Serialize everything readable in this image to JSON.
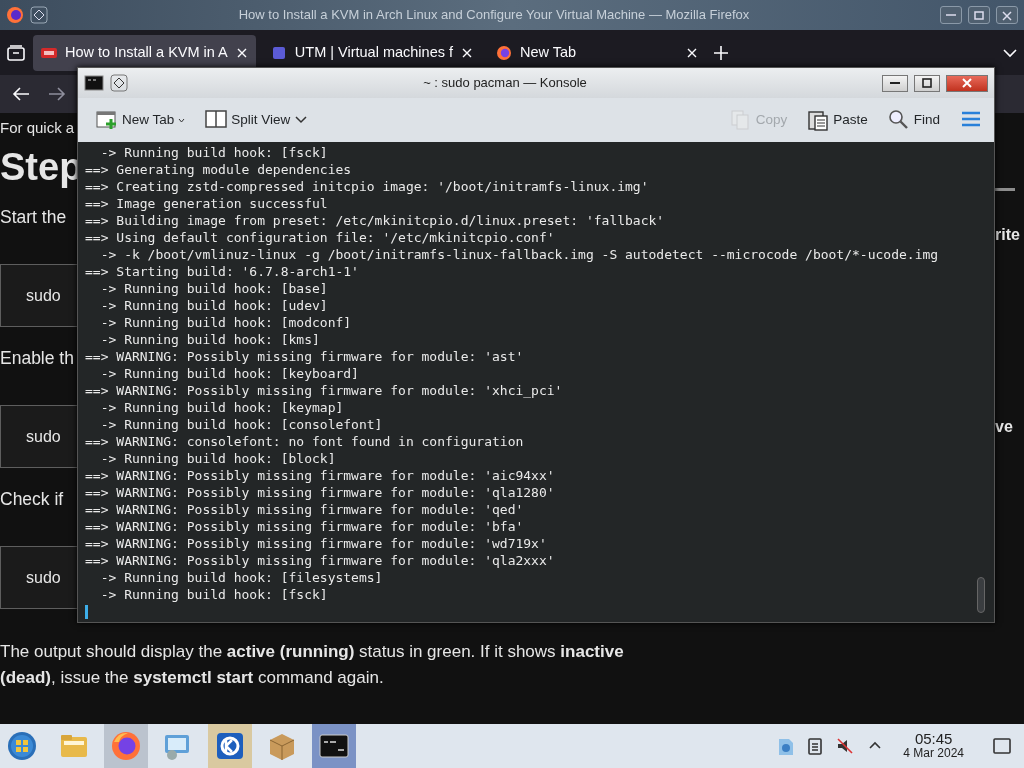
{
  "firefox": {
    "title": "How to Install a KVM in Arch Linux and Configure Your Virtual Machine — Mozilla Firefox",
    "tabs": [
      {
        "label": "How to Install a KVM in A",
        "selected": true,
        "kind": "site"
      },
      {
        "label": "UTM | Virtual machines f",
        "selected": false,
        "kind": "square"
      },
      {
        "label": "New Tab",
        "selected": false,
        "kind": "firefox"
      }
    ],
    "article": [
      {
        "kind": "text",
        "text": "For quick a"
      },
      {
        "kind": "heading",
        "text": "Step"
      },
      {
        "kind": "paragraph",
        "text": "Start the"
      },
      {
        "kind": "code",
        "text": "sudo"
      },
      {
        "kind": "paragraph",
        "text": "Enable th"
      },
      {
        "kind": "code",
        "text": "sudo"
      },
      {
        "kind": "paragraph",
        "text": "Check if"
      },
      {
        "kind": "code",
        "text": "sudo"
      },
      {
        "kind": "paragraph",
        "text": "The output should display the **active (running)** status in green. If it shows **inactive (dead)**, issue the **systemctl start** command again."
      }
    ],
    "sidebar": [
      {
        "kind": "rule"
      },
      {
        "kind": "text",
        "text": "rite"
      },
      {
        "kind": "text",
        "text": "ve"
      }
    ]
  },
  "konsole": {
    "title": "~ : sudo pacman — Konsole",
    "toolbar": [
      {
        "kind": "new-tab",
        "label": "New Tab",
        "disabled": false
      },
      {
        "kind": "split-view",
        "label": "Split View",
        "disabled": false
      },
      {
        "kind": "copy",
        "label": "Copy",
        "disabled": true
      },
      {
        "kind": "paste",
        "label": "Paste",
        "disabled": false
      },
      {
        "kind": "find",
        "label": "Find",
        "disabled": false
      },
      {
        "kind": "menu",
        "disabled": false
      }
    ],
    "lines": [
      "  -> Running build hook: [fsck]",
      "==> Generating module dependencies",
      "==> Creating zstd-compressed initcpio image: '/boot/initramfs-linux.img'",
      "==> Image generation successful",
      "==> Building image from preset: /etc/mkinitcpio.d/linux.preset: 'fallback'",
      "==> Using default configuration file: '/etc/mkinitcpio.conf'",
      "  -> -k /boot/vmlinuz-linux -g /boot/initramfs-linux-fallback.img -S autodetect --microcode /boot/*-ucode.img",
      "==> Starting build: '6.7.8-arch1-1'",
      "  -> Running build hook: [base]",
      "  -> Running build hook: [udev]",
      "  -> Running build hook: [modconf]",
      "  -> Running build hook: [kms]",
      "==> WARNING: Possibly missing firmware for module: 'ast'",
      "  -> Running build hook: [keyboard]",
      "==> WARNING: Possibly missing firmware for module: 'xhci_pci'",
      "  -> Running build hook: [keymap]",
      "  -> Running build hook: [consolefont]",
      "==> WARNING: consolefont: no font found in configuration",
      "  -> Running build hook: [block]",
      "==> WARNING: Possibly missing firmware for module: 'aic94xx'",
      "==> WARNING: Possibly missing firmware for module: 'qla1280'",
      "==> WARNING: Possibly missing firmware for module: 'qed'",
      "==> WARNING: Possibly missing firmware for module: 'bfa'",
      "==> WARNING: Possibly missing firmware for module: 'wd719x'",
      "==> WARNING: Possibly missing firmware for module: 'qla2xxx'",
      "  -> Running build hook: [filesystems]",
      "  -> Running build hook: [fsck]"
    ]
  },
  "taskbar": {
    "apps": [
      {
        "kind": "start",
        "running": false,
        "hovered": false,
        "selected": false
      },
      {
        "kind": "folder",
        "running": false,
        "hovered": false,
        "selected": false
      },
      {
        "kind": "firefox",
        "running": true,
        "hovered": false,
        "selected": false
      },
      {
        "kind": "remote",
        "running": false,
        "hovered": false,
        "selected": false
      },
      {
        "kind": "kde",
        "running": false,
        "hovered": true,
        "selected": false
      },
      {
        "kind": "package",
        "running": false,
        "hovered": false,
        "selected": false
      },
      {
        "kind": "terminal",
        "running": true,
        "hovered": false,
        "selected": true
      }
    ],
    "tray": [
      {
        "kind": "network"
      },
      {
        "kind": "clipboard"
      },
      {
        "kind": "muted"
      },
      {
        "kind": "expand"
      }
    ],
    "clock": {
      "time": "05:45",
      "date": "4 Mar 2024"
    }
  }
}
